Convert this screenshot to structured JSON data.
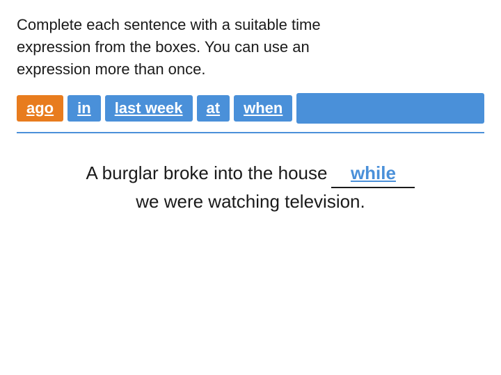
{
  "instruction": {
    "line1": "Complete each sentence with a suitable time",
    "line2": "expression from the boxes. You can use an",
    "line3": "expression more than once."
  },
  "boxes": [
    {
      "id": "ago",
      "label": "ago",
      "style": "orange"
    },
    {
      "id": "in",
      "label": "in",
      "style": "blue"
    },
    {
      "id": "last_week",
      "label": "last week",
      "style": "blue"
    },
    {
      "id": "at",
      "label": "at",
      "style": "blue"
    },
    {
      "id": "when",
      "label": "when",
      "style": "blue"
    },
    {
      "id": "extra",
      "label": "",
      "style": "blue-wide"
    }
  ],
  "sentence": {
    "part1": "A burglar broke into the house",
    "answer": "while",
    "part2": "we were watching television."
  }
}
